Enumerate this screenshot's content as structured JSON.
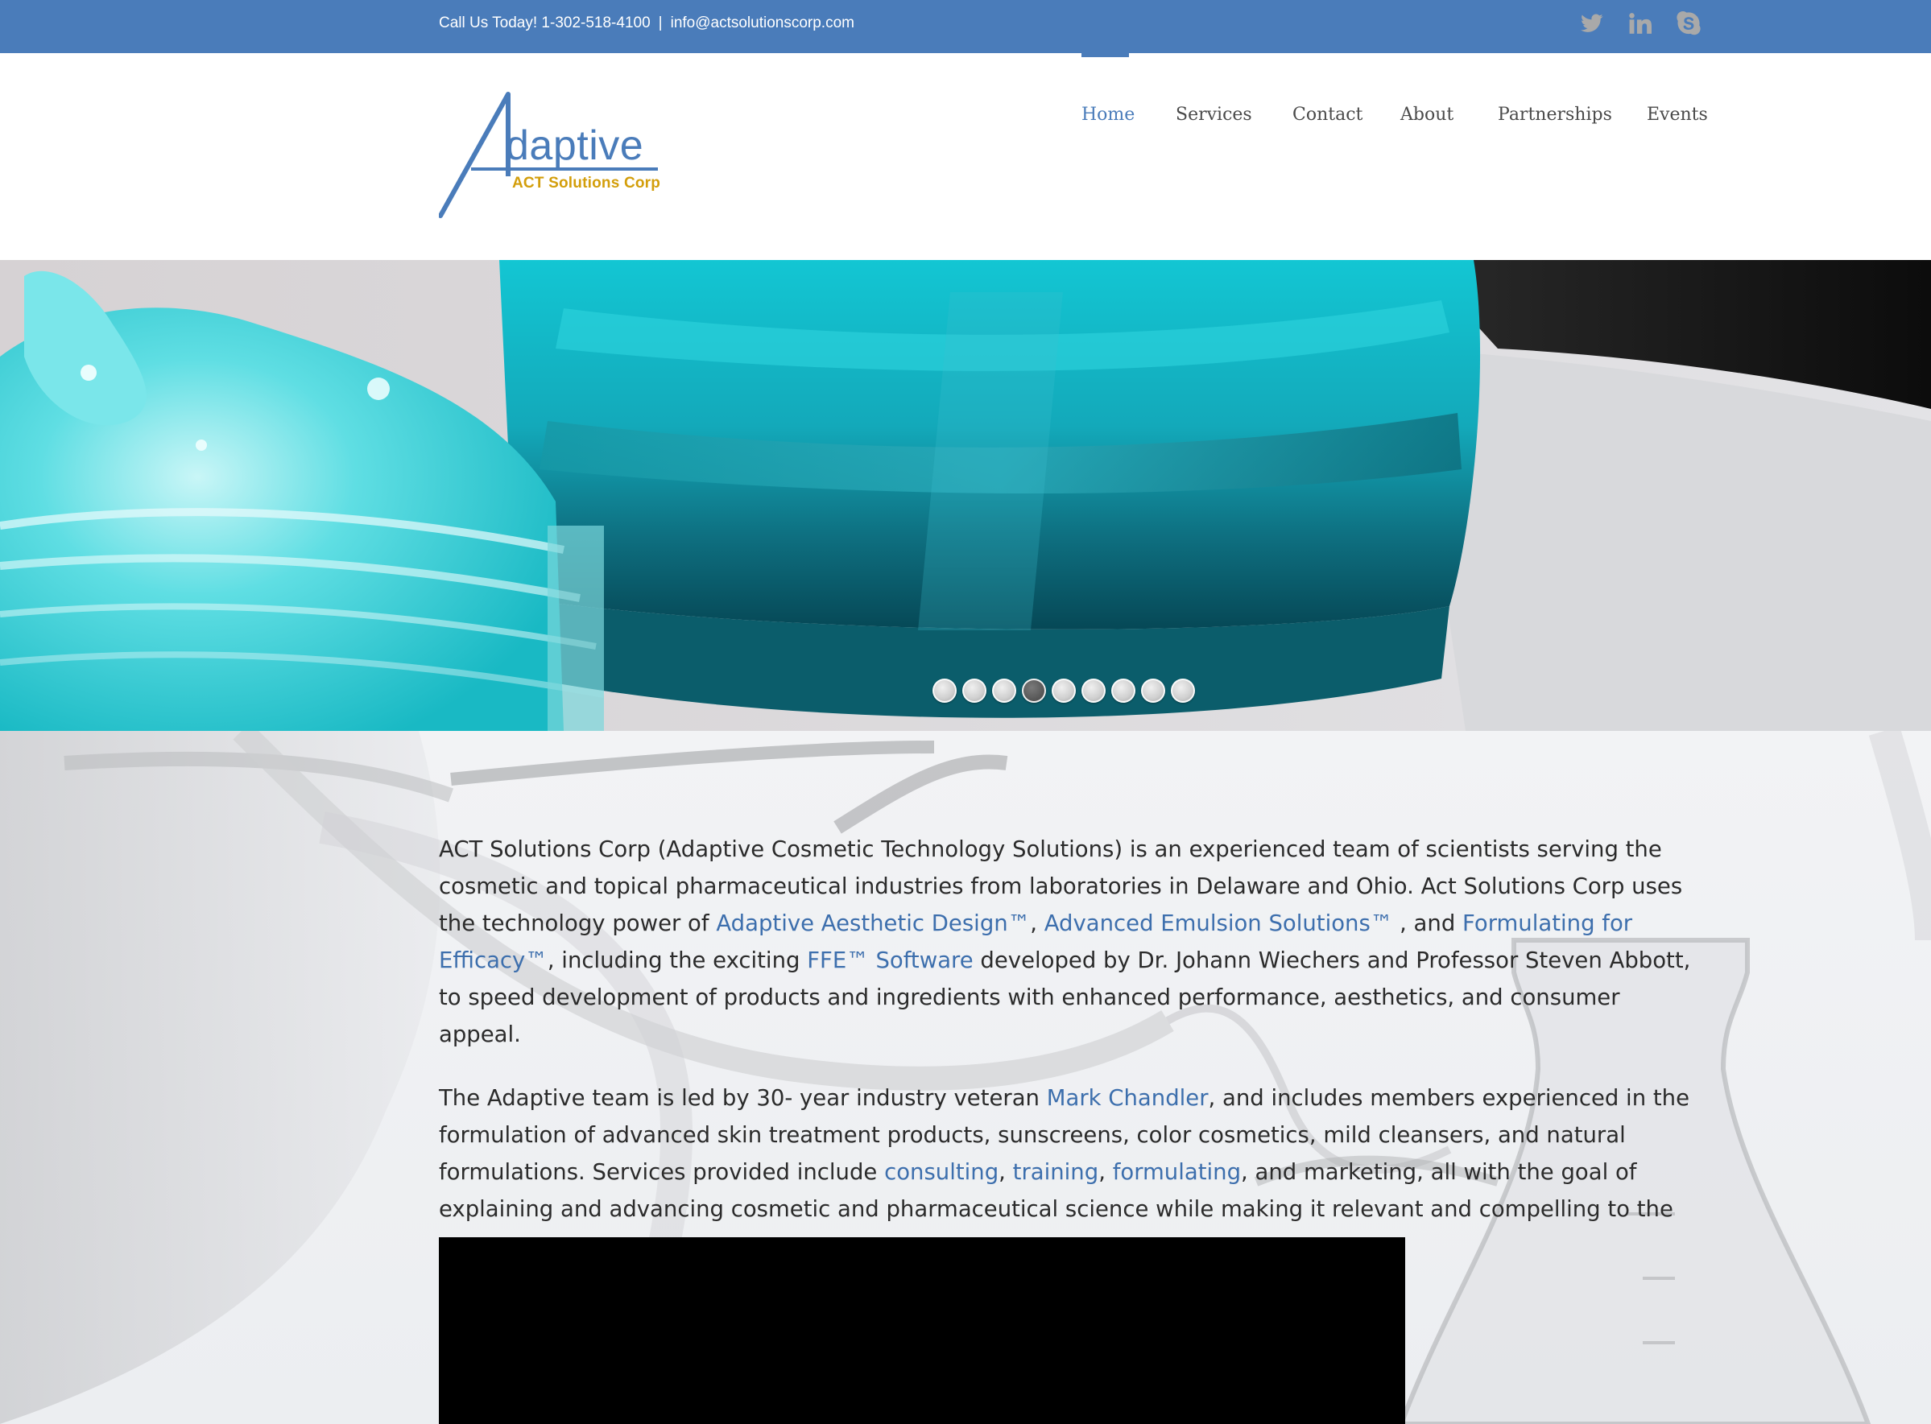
{
  "topbar": {
    "phone_text": "Call Us Today! 1-302-518-4100",
    "separator": "|",
    "email": "info@actsolutionscorp.com",
    "social": [
      "twitter-icon",
      "linkedin-icon",
      "skype-icon"
    ],
    "background_color": "#4a7cba"
  },
  "logo": {
    "word": "daptive",
    "subtitle": "ACT Solutions Corp",
    "primary_color": "#4a7cba",
    "secondary_color": "#d39e0b"
  },
  "nav": {
    "items": [
      {
        "label": "Home",
        "active": true
      },
      {
        "label": "Services",
        "active": false
      },
      {
        "label": "Contact",
        "active": false
      },
      {
        "label": "About",
        "active": false
      },
      {
        "label": "Partnerships",
        "active": false
      },
      {
        "label": "Events",
        "active": false
      }
    ],
    "active_color": "#4a7cba"
  },
  "slider": {
    "dot_count": 9,
    "active_index": 3
  },
  "content": {
    "p1": {
      "t1": "ACT Solutions Corp (Adaptive Cosmetic Technology Solutions) is an experienced team of scientists serving the cosmetic and topical pharmaceutical industries from laboratories in Delaware and Ohio. Act Solutions Corp uses the technology power of ",
      "l1": "Adaptive Aesthetic Design™",
      "t2": ", ",
      "l2": "Advanced Emulsion Solutions™",
      "t3": " , and ",
      "l3": "Formulating for Efficacy™",
      "t4": ", including the exciting ",
      "l4": "FFE™ Software",
      "t5": " developed by Dr. Johann Wiechers and Professor Steven Abbott, to speed development of products and ingredients with enhanced performance, aesthetics, and consumer appeal."
    },
    "p2": {
      "t1": "The Adaptive team is led by 30- year industry veteran ",
      "l1": "Mark Chandler",
      "t2": ", and includes members experienced in the formulation of advanced skin treatment products, sunscreens, color cosmetics, mild cleansers, and natural formulations. Services provided include ",
      "l2": "consulting",
      "t3": ", ",
      "l3": "training",
      "t4": ", ",
      "l4": "formulating",
      "t5": ", and marketing, all with the goal of explaining and advancing cosmetic and pharmaceutical science while making it relevant and compelling to the consumer."
    },
    "link_color": "#3d6fad"
  }
}
